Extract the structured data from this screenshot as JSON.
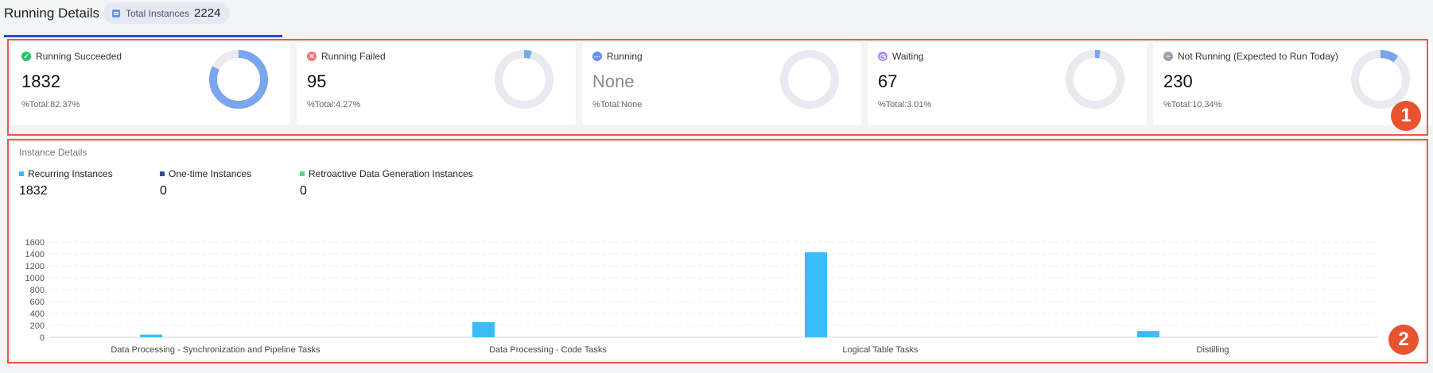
{
  "header": {
    "title": "Running Details",
    "total_label": "Total Instances",
    "total_count": "2224"
  },
  "markers": [
    "1",
    "2"
  ],
  "cards": [
    {
      "label": "Running Succeeded",
      "value": "1832",
      "pct": "%Total:82.37%",
      "status_color": "#22c55e",
      "glyph": "✓",
      "fraction": 0.8237,
      "icon": "check-circle-icon"
    },
    {
      "label": "Running Failed",
      "value": "95",
      "pct": "%Total:4.27%",
      "status_color": "#f87171",
      "glyph": "✕",
      "fraction": 0.0427,
      "icon": "error-circle-icon"
    },
    {
      "label": "Running",
      "value": "None",
      "pct": "%Total:None",
      "status_color": "#6b8ef5",
      "glyph": "⋯",
      "fraction": 0,
      "icon": "ellipsis-circle-icon"
    },
    {
      "label": "Waiting",
      "value": "67",
      "pct": "%Total:3.01%",
      "status_color": "#a78bfa",
      "glyph": "◷",
      "fraction": 0.0301,
      "icon": "clock-circle-icon"
    },
    {
      "label": "Not Running (Expected to Run Today)",
      "value": "230",
      "pct": "%Total:10.34%",
      "status_color": "#9ca3af",
      "glyph": "−",
      "fraction": 0.1034,
      "icon": "minus-circle-icon"
    }
  ],
  "colors": {
    "donut_fill": "#7aa6ee",
    "donut_track": "#e8eaf0",
    "bar": "#38bdf8",
    "accent": "#1d4ed8"
  },
  "instance_details": {
    "title": "Instance Details",
    "legend": [
      {
        "label": "Recurring Instances",
        "value": "1832",
        "color": "#38bdf8"
      },
      {
        "label": "One-time Instances",
        "value": "0",
        "color": "#3b4a8c"
      },
      {
        "label": "Retroactive Data Generation Instances",
        "value": "0",
        "color": "#4ade80"
      }
    ]
  },
  "chart_data": {
    "type": "bar",
    "categories": [
      "Data Processing - Synchronization and Pipeline Tasks",
      "Data Processing - Code Tasks",
      "Logical Table Tasks",
      "Distilling"
    ],
    "series": [
      {
        "name": "Recurring Instances",
        "values": [
          45,
          255,
          1430,
          105
        ]
      },
      {
        "name": "One-time Instances",
        "values": [
          0,
          0,
          0,
          0
        ]
      },
      {
        "name": "Retroactive Data Generation Instances",
        "values": [
          0,
          0,
          0,
          0
        ]
      }
    ],
    "yticks": [
      0,
      200,
      400,
      600,
      800,
      1000,
      1200,
      1400,
      1600
    ],
    "ylim": [
      0,
      1600
    ],
    "grid": true
  }
}
